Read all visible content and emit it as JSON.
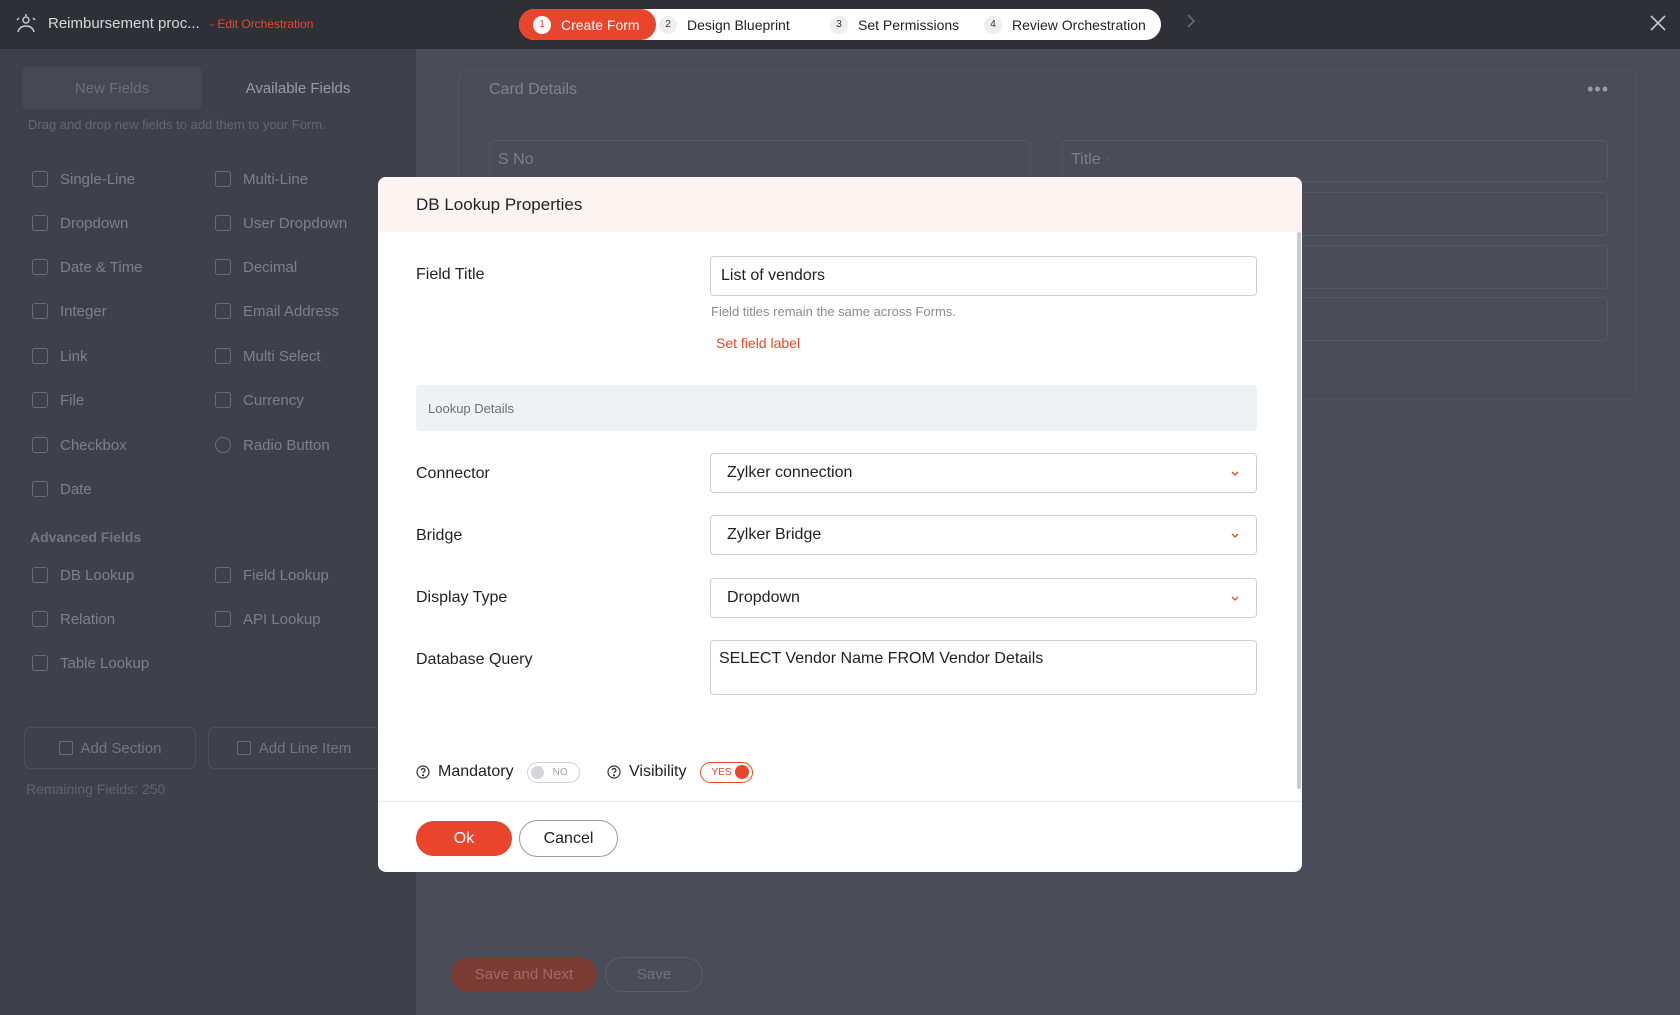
{
  "header": {
    "app_title": "Reimbursement proc...",
    "edit_link": "- Edit Orchestration",
    "steps": [
      {
        "num": "1",
        "label": "Create Form"
      },
      {
        "num": "2",
        "label": "Design Blueprint"
      },
      {
        "num": "3",
        "label": "Set Permissions"
      },
      {
        "num": "4",
        "label": "Review Orchestration"
      }
    ]
  },
  "sidebar": {
    "tabs": {
      "new": "New Fields",
      "available": "Available Fields"
    },
    "hint": "Drag and drop new fields to add them to your Form.",
    "fields": [
      "Single-Line",
      "Multi-Line",
      "Dropdown",
      "User Dropdown",
      "Date & Time",
      "Decimal",
      "Integer",
      "Email Address",
      "Link",
      "Multi Select",
      "File",
      "Currency",
      "Checkbox",
      "Radio Button",
      "Date"
    ],
    "advanced_title": "Advanced Fields",
    "advanced": [
      "DB Lookup",
      "Field Lookup",
      "Relation",
      "API Lookup",
      "Table Lookup"
    ],
    "add_section": "Add Section",
    "add_line_item": "Add Line Item",
    "remaining": "Remaining Fields: 250"
  },
  "card": {
    "title": "Card Details",
    "field_sno": "S No",
    "field_title": "Title",
    "required_mark": "*"
  },
  "bg_buttons": {
    "save_next": "Save and Next",
    "save": "Save"
  },
  "modal": {
    "title": "DB Lookup Properties",
    "field_title_label": "Field Title",
    "field_title_value": "List of vendors",
    "field_title_help": "Field titles remain the same across Forms.",
    "set_field_label": "Set field label",
    "section_title": "Lookup Details",
    "connector_label": "Connector",
    "connector_value": "Zylker connection",
    "bridge_label": "Bridge",
    "bridge_value": "Zylker Bridge",
    "display_type_label": "Display Type",
    "display_type_value": "Dropdown",
    "query_label": "Database Query",
    "query_value": "SELECT Vendor Name FROM Vendor Details",
    "mandatory_label": "Mandatory",
    "mandatory_state": "NO",
    "visibility_label": "Visibility",
    "visibility_state": "YES",
    "ok": "Ok",
    "cancel": "Cancel"
  }
}
